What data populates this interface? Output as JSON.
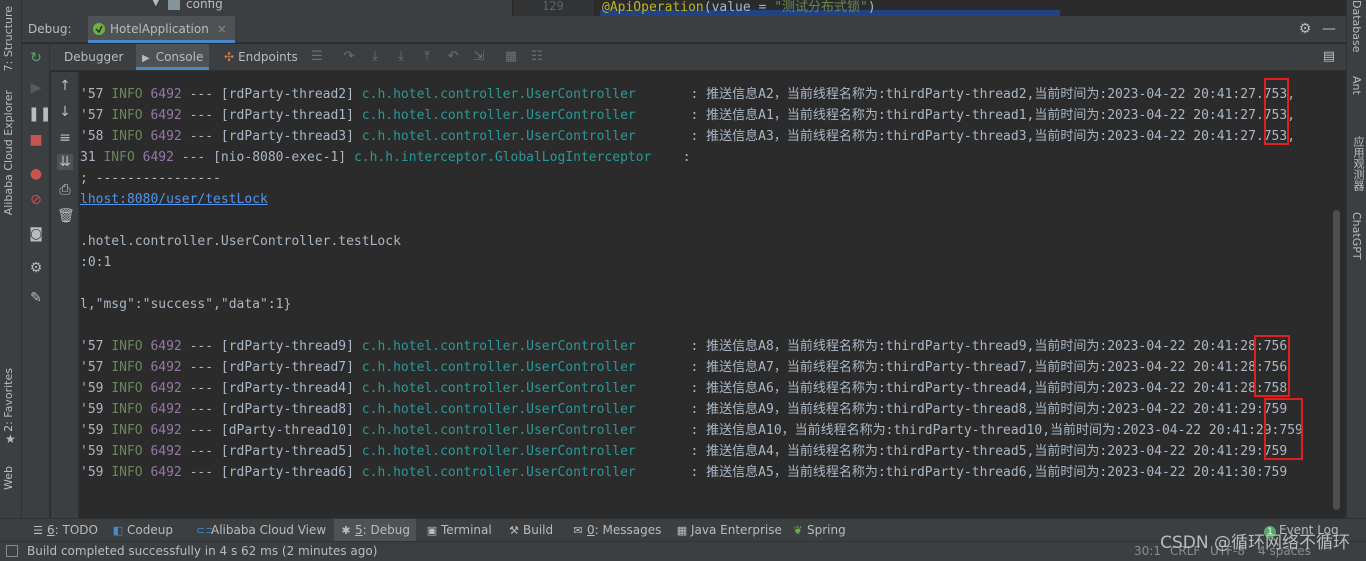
{
  "top": {
    "tree_item": "config",
    "line_number": "129",
    "code_annotation": "@ApiOperation",
    "code_paren_open": "(value = ",
    "code_string": "\"测试分布式锁\"",
    "code_paren_close": ")"
  },
  "left_strip": {
    "structure": "7: Structure",
    "alibaba_explorer": "Alibaba Cloud Explorer",
    "favorites": "2: Favorites",
    "web": "Web"
  },
  "right_strip": {
    "database": "Database",
    "ant": "Ant",
    "chinese": "应用观测器",
    "chatgpt": "ChatGPT"
  },
  "debug_bar": {
    "label": "Debug:",
    "config_name": "HotelApplication",
    "close": "×"
  },
  "debug_tabs": {
    "debugger": "Debugger",
    "console": "Console",
    "endpoints": "Endpoints"
  },
  "console": {
    "lines_a": [
      {
        "ts": "'57",
        "lvl": "INFO",
        "pid": "6492",
        "thread": "--- [rdParty-thread2]",
        "cls": "c.h.hotel.controller.UserController",
        "msg": "      : 推送信息A2，当前线程名称为:thirdParty-thread2,当前时间为:2023-04-22 20:41:27.753,"
      },
      {
        "ts": "'57",
        "lvl": "INFO",
        "pid": "6492",
        "thread": "--- [rdParty-thread1]",
        "cls": "c.h.hotel.controller.UserController",
        "msg": "      : 推送信息A1，当前线程名称为:thirdParty-thread1,当前时间为:2023-04-22 20:41:27.753,"
      },
      {
        "ts": "'58",
        "lvl": "INFO",
        "pid": "6492",
        "thread": "--- [rdParty-thread3]",
        "cls": "c.h.hotel.controller.UserController",
        "msg": "      : 推送信息A3，当前线程名称为:thirdParty-thread3,当前时间为:2023-04-22 20:41:27.753,"
      },
      {
        "ts": "31",
        "lvl": "INFO",
        "pid": "6492",
        "thread": "--- [nio-8080-exec-1]",
        "cls": "c.h.h.interceptor.GlobalLogInterceptor",
        "msg": "   :"
      }
    ],
    "sep": "; ----------------",
    "url": "lhost:8080/user/testLock",
    "method": ".hotel.controller.UserController.testLock",
    "ip": ":0:1",
    "json": "l,\"msg\":\"success\",\"data\":1}",
    "lines_b": [
      {
        "ts": "'57",
        "lvl": "INFO",
        "pid": "6492",
        "thread": "--- [rdParty-thread9]",
        "cls": "c.h.hotel.controller.UserController",
        "msg": "      : 推送信息A8，当前线程名称为:thirdParty-thread9,当前时间为:2023-04-22 20:41:28:756"
      },
      {
        "ts": "'57",
        "lvl": "INFO",
        "pid": "6492",
        "thread": "--- [rdParty-thread7]",
        "cls": "c.h.hotel.controller.UserController",
        "msg": "      : 推送信息A7，当前线程名称为:thirdParty-thread7,当前时间为:2023-04-22 20:41:28:756"
      },
      {
        "ts": "'59",
        "lvl": "INFO",
        "pid": "6492",
        "thread": "--- [rdParty-thread4]",
        "cls": "c.h.hotel.controller.UserController",
        "msg": "      : 推送信息A6，当前线程名称为:thirdParty-thread4,当前时间为:2023-04-22 20:41:28:758"
      },
      {
        "ts": "'59",
        "lvl": "INFO",
        "pid": "6492",
        "thread": "--- [rdParty-thread8]",
        "cls": "c.h.hotel.controller.UserController",
        "msg": "      : 推送信息A9，当前线程名称为:thirdParty-thread8,当前时间为:2023-04-22 20:41:29:759"
      },
      {
        "ts": "'59",
        "lvl": "INFO",
        "pid": "6492",
        "thread": "--- [dParty-thread10]",
        "cls": "c.h.hotel.controller.UserController",
        "msg": "      : 推送信息A10，当前线程名称为:thirdParty-thread10,当前时间为:2023-04-22 20:41:29:759"
      },
      {
        "ts": "'59",
        "lvl": "INFO",
        "pid": "6492",
        "thread": "--- [rdParty-thread5]",
        "cls": "c.h.hotel.controller.UserController",
        "msg": "      : 推送信息A4，当前线程名称为:thirdParty-thread5,当前时间为:2023-04-22 20:41:29:759"
      },
      {
        "ts": "'59",
        "lvl": "INFO",
        "pid": "6492",
        "thread": "--- [rdParty-thread6]",
        "cls": "c.h.hotel.controller.UserController",
        "msg": "      : 推送信息A5，当前线程名称为:thirdParty-thread6,当前时间为:2023-04-22 20:41:30:759"
      }
    ]
  },
  "bottom_tabs": {
    "todo_num": "6",
    "todo": ": TODO",
    "codeup": "Codeup",
    "alibaba_view": "Alibaba Cloud View",
    "debug_num": "5",
    "debug": ": Debug",
    "terminal": "Terminal",
    "build": "Build",
    "messages_num": "0",
    "messages": ": Messages",
    "java_enterprise": "Java Enterprise",
    "spring": "Spring",
    "event_log_count": "1",
    "event_log": "Event Log"
  },
  "status": {
    "message": "Build completed successfully in 4 s 62 ms (2 minutes ago)",
    "position": "30:1",
    "line_sep": "CRLF",
    "encoding": "UTF-8",
    "indent": "4 spaces"
  },
  "watermark": "CSDN @循环网络不循环",
  "colors": {
    "accent": "#4a88c7",
    "highlight_box": "#e02020",
    "info_level": "#6a8759",
    "class_name": "#299999",
    "pid": "#9876aa"
  }
}
